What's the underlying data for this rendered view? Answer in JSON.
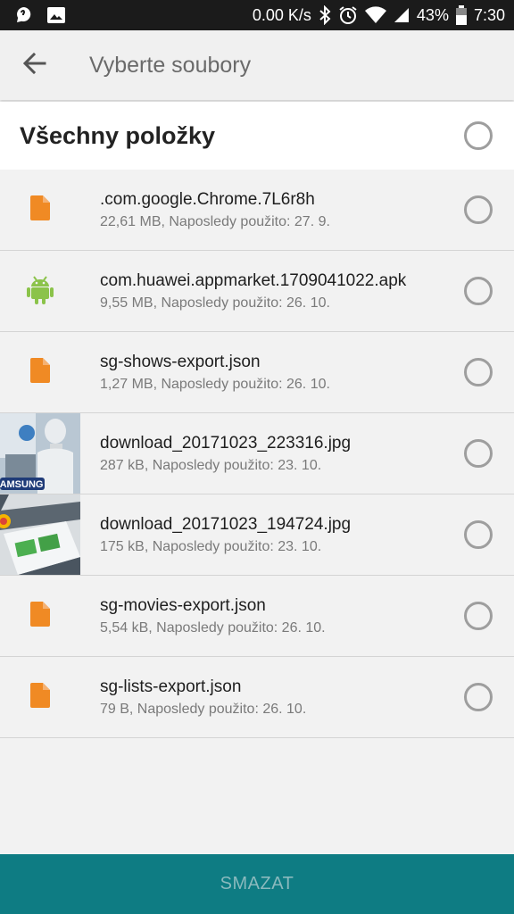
{
  "statusbar": {
    "net_speed": "0.00 K/s",
    "battery": "43%",
    "time": "7:30"
  },
  "toolbar": {
    "title": "Vyberte soubory"
  },
  "select_all": {
    "label": "Všechny položky"
  },
  "files": [
    {
      "name": ".com.google.Chrome.7L6r8h",
      "meta": "22,61 MB, Naposledy použito: 27. 9.",
      "icon": "file-icon"
    },
    {
      "name": "com.huawei.appmarket.1709041022.apk",
      "meta": "9,55 MB, Naposledy použito: 26. 10.",
      "icon": "android-icon"
    },
    {
      "name": "sg-shows-export.json",
      "meta": "1,27 MB, Naposledy použito: 26. 10.",
      "icon": "file-icon"
    },
    {
      "name": "download_20171023_223316.jpg",
      "meta": "287 kB, Naposledy použito: 23. 10.",
      "icon": "image-thumbnail"
    },
    {
      "name": "download_20171023_194724.jpg",
      "meta": "175 kB, Naposledy použito: 23. 10.",
      "icon": "image-thumbnail"
    },
    {
      "name": "sg-movies-export.json",
      "meta": "5,54 kB, Naposledy použito: 26. 10.",
      "icon": "file-icon"
    },
    {
      "name": "sg-lists-export.json",
      "meta": "79 B, Naposledy použito: 26. 10.",
      "icon": "file-icon"
    }
  ],
  "thumbnail_text": {
    "samsung": "AMSUNG"
  },
  "actions": {
    "delete_label": "SMAZAT"
  },
  "colors": {
    "accent": "#0e7c83",
    "file_icon": "#f08a24",
    "android_icon": "#8bc34a"
  }
}
